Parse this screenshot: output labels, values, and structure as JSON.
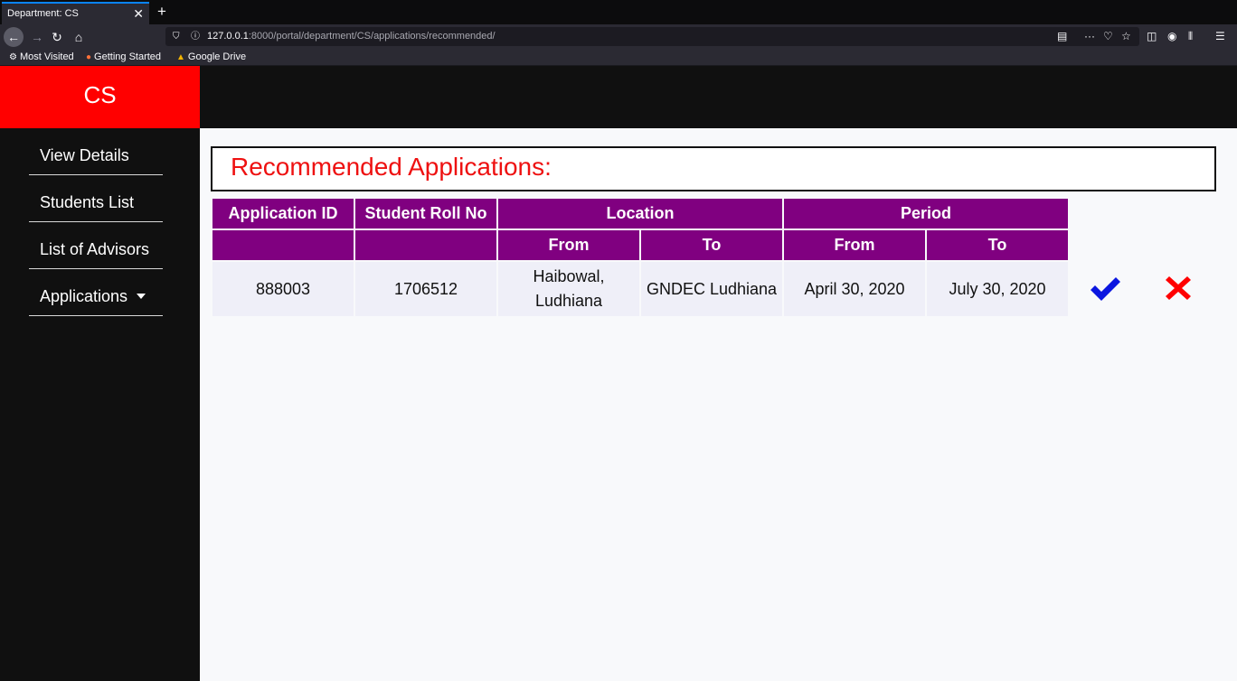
{
  "browser": {
    "tab_title": "Department: CS",
    "url_host": "127.0.0.1",
    "url_rest": ":8000/portal/department/CS/applications/recommended/",
    "bookmarks": [
      "Most Visited",
      "Getting Started",
      "Google Drive"
    ]
  },
  "brand": "CS",
  "sidebar": {
    "items": [
      {
        "label": "View Details"
      },
      {
        "label": "Students List"
      },
      {
        "label": "List of Advisors"
      },
      {
        "label": "Applications"
      }
    ]
  },
  "main": {
    "heading": "Recommended Applications:",
    "table": {
      "headers": {
        "application_id": "Application ID",
        "student_roll_no": "Student Roll No",
        "location": "Location",
        "period": "Period",
        "from": "From",
        "to": "To"
      },
      "rows": [
        {
          "application_id": "888003",
          "student_roll_no": "1706512",
          "location_from": "Haibowal, Ludhiana",
          "location_to": "GNDEC Ludhiana",
          "period_from": "April 30, 2020",
          "period_to": "July 30, 2020"
        }
      ]
    }
  },
  "colors": {
    "brand_red": "#ff0000",
    "header_purple": "#800080",
    "heading_red": "#ee1111",
    "approve_blue": "#0b16e0",
    "reject_red": "#ff0000"
  }
}
